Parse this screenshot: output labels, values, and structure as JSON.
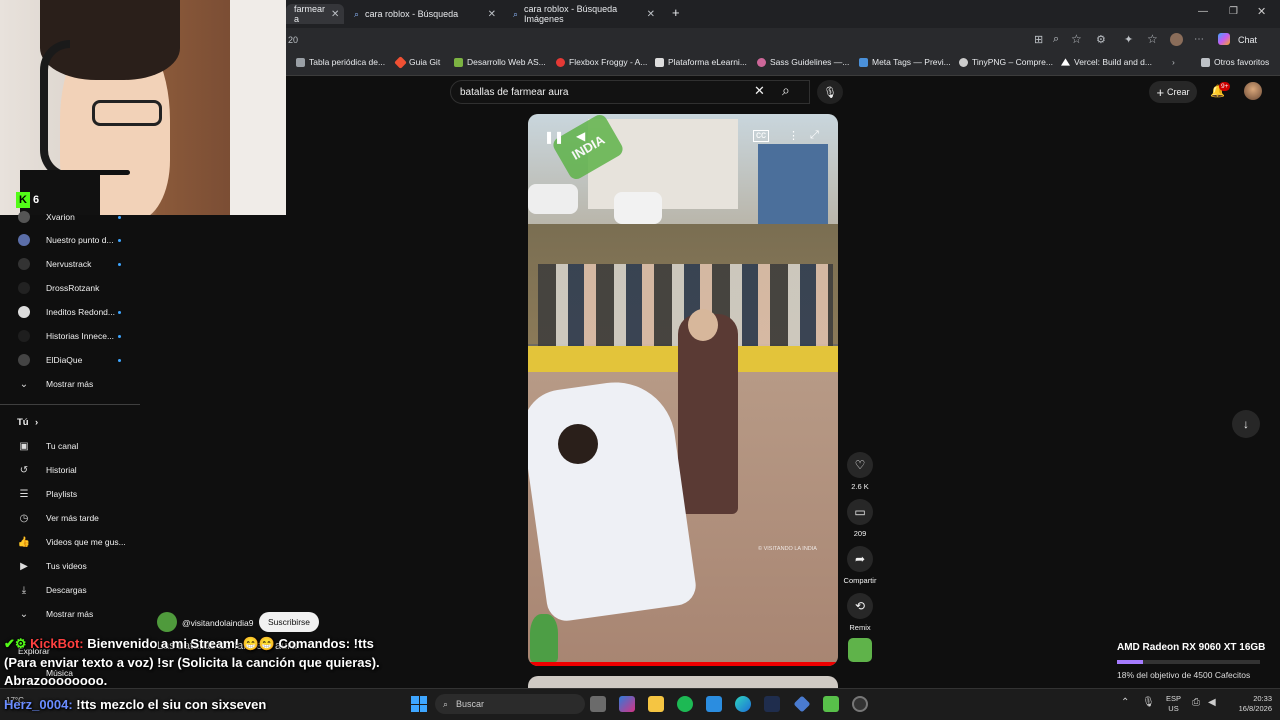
{
  "browser": {
    "tabs": [
      {
        "label": "farmear a"
      },
      {
        "label": "cara roblox - Búsqueda"
      },
      {
        "label": "cara roblox - Búsqueda Imágenes"
      }
    ],
    "new_tab": "+",
    "address_fragment": "20",
    "toolbar_chat": "Chat",
    "bookmarks": [
      "Tabla periódica de...",
      "Guia Git",
      "Desarrollo Web AS...",
      "Flexbox Froggy - A...",
      "Plataforma eLearni...",
      "Sass Guidelines —...",
      "Meta Tags — Previ...",
      "TinyPNG – Compre...",
      "Vercel: Build and d...",
      "Otros favoritos"
    ]
  },
  "search": {
    "query": "batallas de farmear aura"
  },
  "header": {
    "create_label": "Crear",
    "notif_count": "9+"
  },
  "webcam": {
    "kick_count": "6"
  },
  "sidebar": {
    "subs": [
      {
        "label": "Xvarion"
      },
      {
        "label": "Nuestro punto d..."
      },
      {
        "label": "Nervustrack"
      },
      {
        "label": "DrossRotzank"
      },
      {
        "label": "Ineditos Redond..."
      },
      {
        "label": "Historias Innece..."
      },
      {
        "label": "ElDiaQue"
      }
    ],
    "show_more_1": "Mostrar más",
    "you_header": "Tú",
    "you_items": [
      {
        "label": "Tu canal",
        "icon": "user-square-icon"
      },
      {
        "label": "Historial",
        "icon": "history-icon"
      },
      {
        "label": "Playlists",
        "icon": "playlist-icon"
      },
      {
        "label": "Ver más tarde",
        "icon": "clock-icon"
      },
      {
        "label": "Videos que me gus...",
        "icon": "thumbs-up-icon"
      },
      {
        "label": "Tus videos",
        "icon": "video-icon"
      },
      {
        "label": "Descargas",
        "icon": "download-icon"
      }
    ],
    "show_more_2": "Mostrar más",
    "explore": "Explorar",
    "music": "Música"
  },
  "short": {
    "channel": "@visitandolaindia9",
    "subscribe": "Suscribirse",
    "title": "Las batallas de farmear aura",
    "watermark": "© VISITANDO LA INDIA",
    "sticker": "INDIA",
    "likes": "2.6 K",
    "comments": "209",
    "share": "Compartir",
    "remix": "Remix"
  },
  "overlay": {
    "chat1_user": "KickBot:",
    "chat1_text": "Bienvenido a mi Stream! 😁😁 Comandos: !tts",
    "chat1_line2": "(Para enviar texto a voz) !sr (Solicita la canción que quieras).",
    "chat1_line3": "Abrazoooooooo.",
    "chat2_user": "Herz_0004:",
    "chat2_text": "!tts mezclo el siu con sixseven",
    "goal_title": "AMD Radeon RX 9060 XT 16GB",
    "goal_text": "18% del objetivo de 4500 Cafecitos",
    "goal_progress": 0.18
  },
  "taskbar": {
    "search": "Buscar",
    "weather": "17°C",
    "lang1": "ESP",
    "lang2": "US",
    "time": "20:33",
    "date": "16/8/2026"
  },
  "colors": {
    "accent": "#3ea6ff",
    "kick_green": "#53fc18",
    "goal_bar": "#a67cff",
    "notif_red": "#cc0000"
  }
}
